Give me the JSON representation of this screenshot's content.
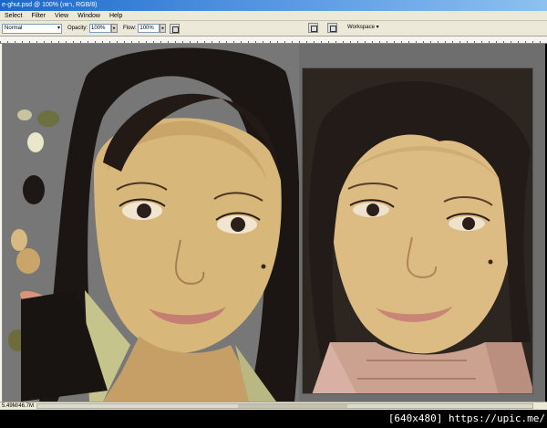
{
  "window": {
    "title": "e-ghut.psd @ 100% (เพา, RGB/8)"
  },
  "menu": {
    "items": [
      "Select",
      "Filter",
      "View",
      "Window",
      "Help"
    ]
  },
  "options": {
    "blend_mode": "Normal",
    "opacity_label": "Opacity:",
    "opacity_value": "100%",
    "flow_label": "Flow:",
    "flow_value": "100%",
    "workspace_label": "Workspace"
  },
  "status": {
    "doc_size": "5.49M/46.7M"
  },
  "watermark": "[640x480] https://upic.me/"
}
